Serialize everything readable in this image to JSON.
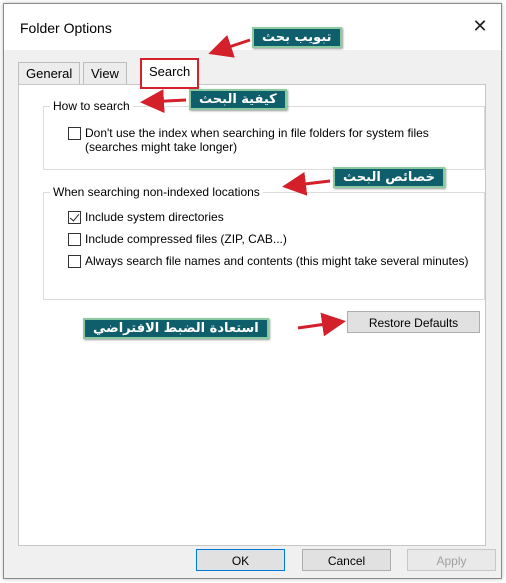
{
  "dialog": {
    "title": "Folder Options",
    "close_glyph": "✕"
  },
  "tabs": [
    {
      "label": "General"
    },
    {
      "label": "View"
    },
    {
      "label": "Search",
      "selected": true
    }
  ],
  "how_to_search": {
    "legend": "How to search",
    "option": {
      "label": "Don't use the index when searching in file folders for system files (searches might take longer)",
      "checked": false
    }
  },
  "non_indexed": {
    "legend": "When searching non-indexed locations",
    "options": [
      {
        "label": "Include system directories",
        "checked": true
      },
      {
        "label": "Include compressed files (ZIP, CAB...)",
        "checked": false
      },
      {
        "label": "Always search file names and contents (this might take several minutes)",
        "checked": false
      }
    ]
  },
  "buttons": {
    "restore": "Restore Defaults",
    "ok": "OK",
    "cancel": "Cancel",
    "apply": "Apply"
  },
  "annotations": {
    "search_tab": "تبويب بحث",
    "how_to_search": "كيفية البحث",
    "search_properties": "خصائص البحث",
    "restore_defaults": "استعادة الضبط الافتراضي",
    "callout_color": "#0f5e6b",
    "arrow_color": "#d4202a"
  }
}
